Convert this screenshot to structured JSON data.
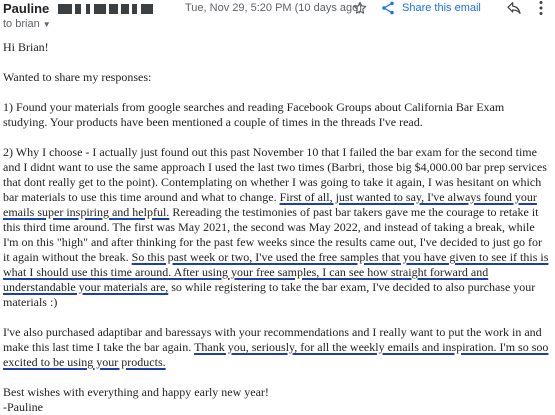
{
  "header": {
    "sender_name": "Pauline",
    "date": "Tue, Nov 29, 5:20 PM (10 days ago)",
    "share_label": "Share this email",
    "to_line": "to brian"
  },
  "icons": {
    "star": "star-icon",
    "share": "share-icon",
    "reply": "reply-icon",
    "more": "more-vert-icon"
  },
  "colors": {
    "underline": "#1d3fae",
    "link": "#1a73e8"
  },
  "body": {
    "greeting": "Hi Brian!",
    "intro": "Wanted to share my responses:",
    "p1": "1) Found your materials from google searches and reading Facebook Groups about California Bar Exam studying. Your products have been mentioned a couple of times in the threads I've read.",
    "p2_a": "2) Why I choose - I actually just found out this past November 10 that I failed the bar exam for the second time and I didnt want to use the same approach I used the last two times (Barbri, those big $4,000.00 bar prep services that dont really get to the point). Contemplating on whether I was going to take it again, I was hesitant on which bar materials to use this time around and what to change. ",
    "p2_u1": "First of all, just wanted to say, I've always found your emails super inspiring and helpful.",
    "p2_b": " Rereading the testimonies of past bar takers gave me the courage to retake it this third time around. The first was May 2021, the second was May 2022, and instead of taking a break, while I'm on this \"high\" and after thinking for the past few weeks since the results came out, I've decided to just go for it again without the break. ",
    "p2_u2": "So this past week or two, I've used the free samples that you have given to see if this is what I should use this time around. After using your free samples, I can see how straight forward and understandable your materials are,",
    "p2_c": " so while registering to take the bar exam, I've decided to also purchase your materials :)",
    "p3_a": "I've also purchased adaptibar and baressays with your recommendations and I really want to put the work in and make this last time I take the bar again. ",
    "p3_u": "Thank you, seriously, for all the weekly emails and inspiration. I'm so soo excited to be using your products.",
    "closing": "Best wishes with everything and happy early new year!",
    "signature": "-Pauline"
  }
}
